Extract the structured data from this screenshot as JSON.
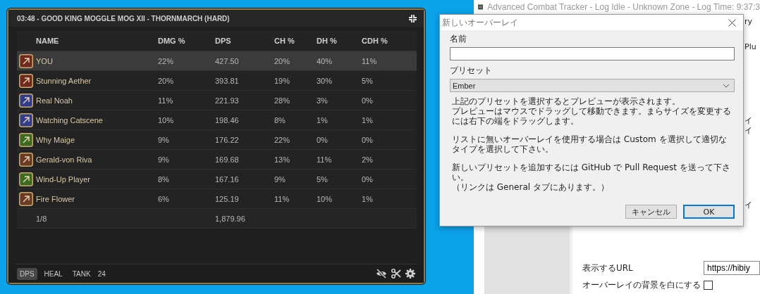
{
  "overlay": {
    "title": "03:48 - GOOD KING MOGGLE MOG XII - THORNMARCH (HARD)",
    "columns": [
      "NAME",
      "DMG %",
      "DPS",
      "CH %",
      "DH %",
      "CDH %"
    ],
    "rows": [
      {
        "cells": [
          "YOU",
          "22%",
          "427.50",
          "20%",
          "40%",
          "11%"
        ],
        "color": "#6e2a1f",
        "selected": true
      },
      {
        "cells": [
          "Stunning Aether",
          "20%",
          "393.81",
          "19%",
          "30%",
          "5%"
        ],
        "color": "#6e2a1f",
        "selected": false
      },
      {
        "cells": [
          "Real Noah",
          "11%",
          "221.93",
          "28%",
          "3%",
          "0%"
        ],
        "color": "#303c8c",
        "selected": false
      },
      {
        "cells": [
          "Watching Catscene",
          "10%",
          "198.46",
          "8%",
          "1%",
          "1%"
        ],
        "color": "#303c8c",
        "selected": false
      },
      {
        "cells": [
          "Why Maige",
          "9%",
          "176.22",
          "22%",
          "0%",
          "0%"
        ],
        "color": "#3b6a22",
        "selected": false
      },
      {
        "cells": [
          "Gerald-von Riva",
          "9%",
          "169.68",
          "13%",
          "11%",
          "2%"
        ],
        "color": "#6a3a24",
        "selected": false
      },
      {
        "cells": [
          "Wind-Up Player",
          "8%",
          "167.16",
          "9%",
          "5%",
          "0%"
        ],
        "color": "#3b6a22",
        "selected": false
      },
      {
        "cells": [
          "Fire Flower",
          "6%",
          "125.19",
          "11%",
          "10%",
          "1%"
        ],
        "color": "#6a3a24",
        "selected": false
      }
    ],
    "total": {
      "count": "1/8",
      "dps": "1,879.96"
    },
    "tabs": [
      {
        "label": "DPS",
        "selected": true
      },
      {
        "label": "HEAL",
        "selected": false
      },
      {
        "label": "TANK",
        "selected": false
      }
    ],
    "count": "24"
  },
  "act_window": {
    "title": "Advanced Combat Tracker - Log Idle - Unknown Zone - Log Time: 9:37:3",
    "fragments": [
      "ry",
      "Plu",
      "イ",
      "イ",
      "イ"
    ],
    "url_label": "表示するURL",
    "url_value": "https://hibiy",
    "white_background_label": "オーバーレイの背景を白にする",
    "white_background_checked": false
  },
  "dialog": {
    "title": "新しいオーバーレイ",
    "name_label": "名前",
    "preset_label": "プリセット",
    "preset_value": "Ember",
    "paragraphs": [
      [
        "上記のプリセットを選択するとプレビューが表示されます。",
        "プレビューはマウスでドラッグして移動できます。まらサイズを変更するには右下の端をドラッグします。"
      ],
      [
        "リストに無いオーバーレイを使用する場合は Custom を選択して適切なタイプを選択して下さい。"
      ],
      [
        "新しいプリセットを追加するには GitHub で Pull Request を送って下さい。",
        "（リンクは General タブにあります。）"
      ]
    ],
    "buttons": [
      {
        "label": "キャンセル",
        "selected": false
      },
      {
        "label": "OK",
        "selected": true
      }
    ]
  }
}
